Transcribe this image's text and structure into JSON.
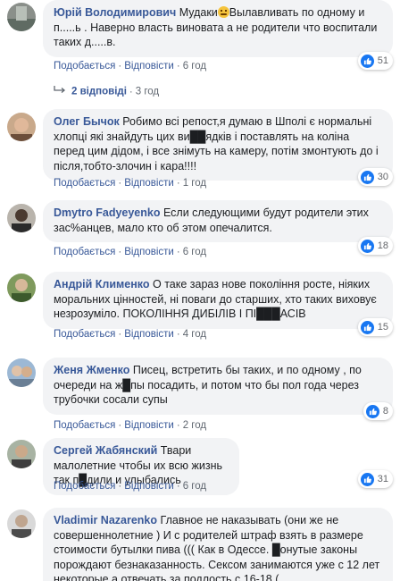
{
  "comments": [
    {
      "author": "Юрій Володимирович",
      "text_before_emoji": "Мудаки",
      "emoji": "angry-face",
      "text_after_emoji": "Вылавливать по одному и п.....ь . Наверно власть виновата а не родители что воспитали таких д.....в.",
      "like": "Подобається",
      "reply": "Відповісти",
      "time": "6 год",
      "reactions": "51",
      "replies_label": "2 відповіді",
      "replies_time": "3 год"
    },
    {
      "author": "Олег Бычок",
      "text": "Робимо всі репост,я думаю в Шполі є нормальні хлопці які знайдуть цих ви██ядків і поставлять на коліна перед цим дідом, і все знімуть на камеру, потім змонтують до і після,тобто-злочин і кара!!!!",
      "like": "Подобається",
      "reply": "Відповісти",
      "time": "1 год",
      "reactions": "30"
    },
    {
      "author": "Dmytro Fadyeyenko",
      "text": "Если следующими будут родители этих зас%анцев, мало кто об этом опечалится.",
      "like": "Подобається",
      "reply": "Відповісти",
      "time": "6 год",
      "reactions": "18"
    },
    {
      "author": "Андрій Клименко",
      "text": "О таке зараз нове покоління росте, ніяких моральних цінностей, ні поваги до старших, хто таких виховує незрозуміло. ПОКОЛІННЯ ДИБІЛІВ І ПІ███АСІВ",
      "like": "Подобається",
      "reply": "Відповісти",
      "time": "4 год",
      "reactions": "15"
    },
    {
      "author": "Женя Жменко",
      "text": "Писец, встретить бы таких, и по одному , по очереди на ж█пы посадить, и потом что бы пол года через трубочки сосали супы",
      "like": "Подобається",
      "reply": "Відповісти",
      "time": "2 год",
      "reactions": "8"
    },
    {
      "author": "Сергей Жабянский",
      "text": "Твари малолетние чтобы их всю жизнь так п█дили и улыбались",
      "like": "Подобається",
      "reply": "Відповісти",
      "time": "6 год",
      "reactions": "31"
    },
    {
      "author": "Vladimir Nazarenko",
      "text": "Главное не наказывать (они же не совершеннолетние ) И с родителей штраф взять в размере стоимости бутылки пива ((( Как в Одессе. █онутые законы порождают безнаказанность. Сексом занимаются уже с 12 лет некоторые,а отвечать за подлость с 16-18 (",
      "reactions": ""
    }
  ],
  "colors": {
    "link": "#385898",
    "bubble": "#f2f3f5",
    "like_blue": "#1877f2",
    "meta_gray": "#606770"
  }
}
